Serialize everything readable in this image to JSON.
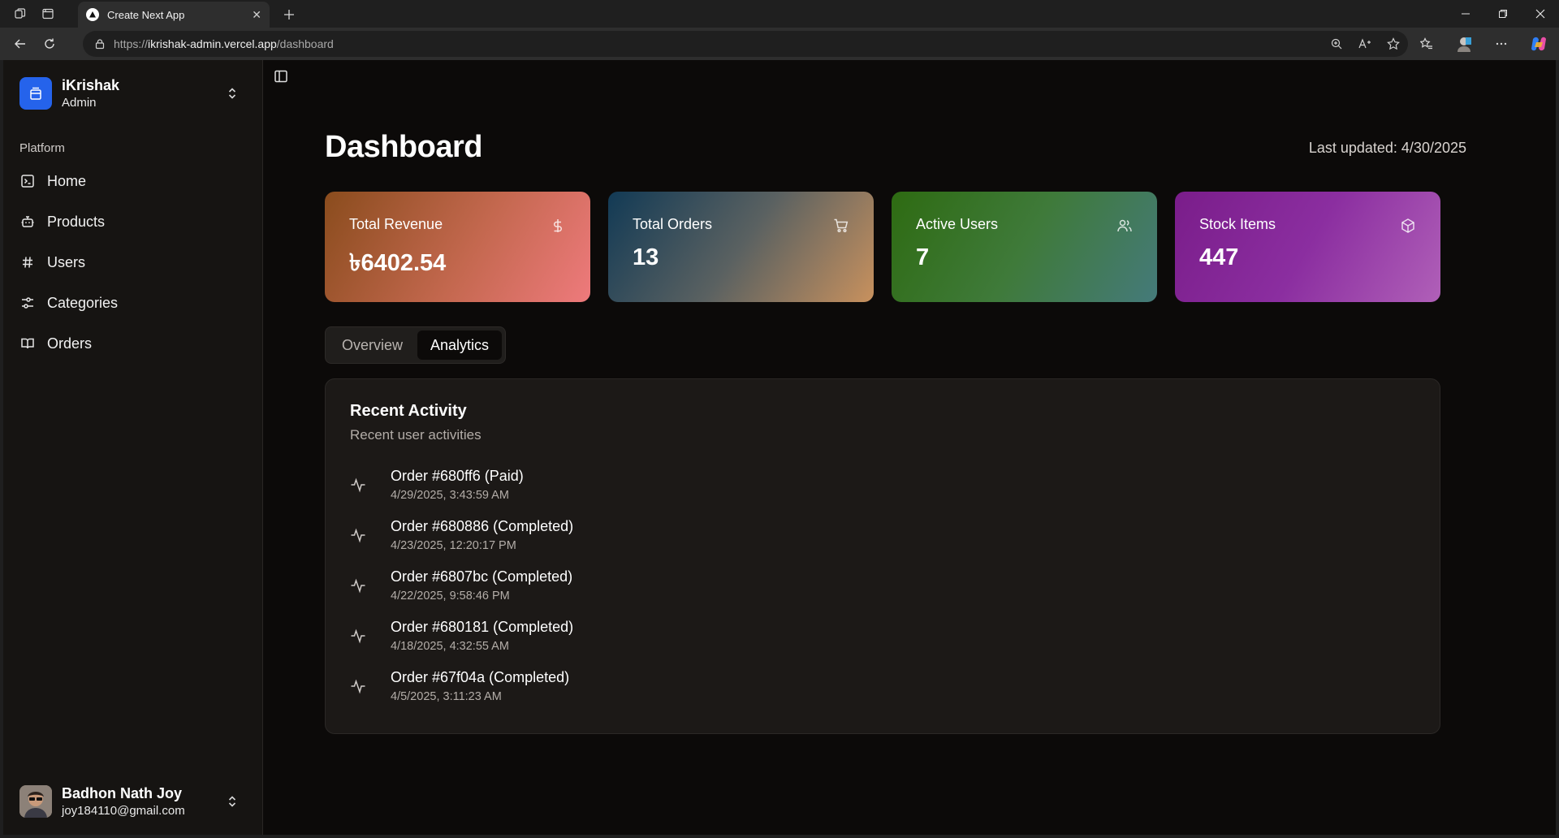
{
  "browser": {
    "tab_title": "Create Next App",
    "url_prefix": "https://",
    "url_host": "ikrishak-admin.vercel.app",
    "url_path": "/dashboard"
  },
  "sidebar": {
    "brand_name": "iKrishak",
    "brand_role": "Admin",
    "group_label": "Platform",
    "items": [
      {
        "label": "Home",
        "icon": "terminal-square-icon"
      },
      {
        "label": "Products",
        "icon": "bot-icon"
      },
      {
        "label": "Users",
        "icon": "hash-icon"
      },
      {
        "label": "Categories",
        "icon": "settings-sliders-icon"
      },
      {
        "label": "Orders",
        "icon": "book-open-icon"
      }
    ],
    "user_name": "Badhon Nath Joy",
    "user_email": "joy184110@gmail.com"
  },
  "header": {
    "title": "Dashboard",
    "last_updated": "Last updated: 4/30/2025"
  },
  "stats": [
    {
      "label": "Total Revenue",
      "value": "৳6402.54",
      "icon": "dollar-icon"
    },
    {
      "label": "Total Orders",
      "value": "13",
      "icon": "cart-icon"
    },
    {
      "label": "Active Users",
      "value": "7",
      "icon": "users-icon"
    },
    {
      "label": "Stock Items",
      "value": "447",
      "icon": "box-icon"
    }
  ],
  "tabs": [
    {
      "label": "Overview",
      "active": false
    },
    {
      "label": "Analytics",
      "active": true
    }
  ],
  "activity": {
    "title": "Recent Activity",
    "subtitle": "Recent user activities",
    "items": [
      {
        "text": "Order #680ff6 (Paid)",
        "time": "4/29/2025, 3:43:59 AM"
      },
      {
        "text": "Order #680886 (Completed)",
        "time": "4/23/2025, 12:20:17 PM"
      },
      {
        "text": "Order #6807bc (Completed)",
        "time": "4/22/2025, 9:58:46 PM"
      },
      {
        "text": "Order #680181 (Completed)",
        "time": "4/18/2025, 4:32:55 AM"
      },
      {
        "text": "Order #67f04a (Completed)",
        "time": "4/5/2025, 3:11:23 AM"
      }
    ]
  },
  "colors": {
    "accent": "#2563eb",
    "background": "#0c0a09",
    "sidebar": "#161412"
  }
}
